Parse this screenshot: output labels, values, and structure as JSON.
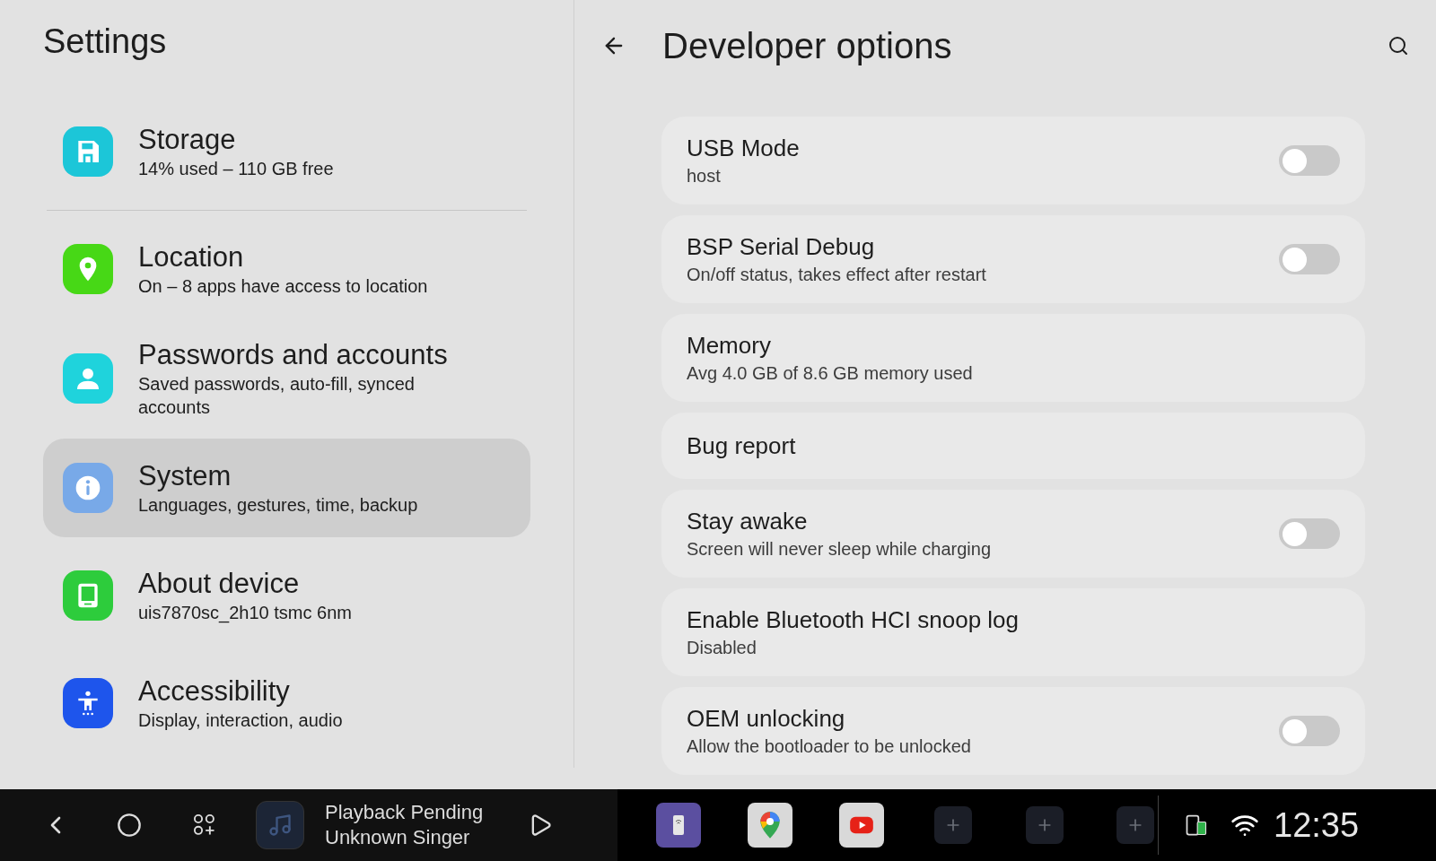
{
  "settings": {
    "title": "Settings",
    "items": [
      {
        "kind": "storage",
        "color": "#1cc6d8",
        "title": "Storage",
        "subtitle": "14% used – 110 GB free",
        "selected": false
      },
      {
        "kind": "location",
        "color": "#47d816",
        "title": "Location",
        "subtitle": "On – 8 apps have access to location",
        "selected": false
      },
      {
        "kind": "person",
        "color": "#1fd3dc",
        "title": "Passwords and accounts",
        "subtitle": "Saved passwords, auto-fill, synced accounts",
        "selected": false
      },
      {
        "kind": "info",
        "color": "#78a9e8",
        "title": "System",
        "subtitle": "Languages, gestures, time, backup",
        "selected": true
      },
      {
        "kind": "tablet",
        "color": "#2dcc3c",
        "title": "About device",
        "subtitle": "uis7870sc_2h10 tsmc 6nm",
        "selected": false
      },
      {
        "kind": "accessibility",
        "color": "#1e55ec",
        "title": "Accessibility",
        "subtitle": "Display, interaction, audio",
        "selected": false
      }
    ]
  },
  "developer": {
    "title": "Developer options",
    "options": [
      {
        "kind": "toggle",
        "title": "USB Mode",
        "subtitle": "host",
        "on": false
      },
      {
        "kind": "toggle",
        "title": "BSP Serial Debug",
        "subtitle": "On/off status, takes effect after restart",
        "on": false
      },
      {
        "kind": "info",
        "title": "Memory",
        "subtitle": "Avg 4.0 GB of 8.6 GB memory used"
      },
      {
        "kind": "info",
        "title": "Bug report"
      },
      {
        "kind": "toggle",
        "title": "Stay awake",
        "subtitle": "Screen will never sleep while charging",
        "on": false
      },
      {
        "kind": "info",
        "title": "Enable Bluetooth HCI snoop log",
        "subtitle": "Disabled"
      },
      {
        "kind": "toggle",
        "title": "OEM unlocking",
        "subtitle": "Allow the bootloader to be unlocked",
        "on": false
      }
    ]
  },
  "taskbar": {
    "media": {
      "title": "Playback Pending",
      "artist": "Unknown Singer"
    },
    "apps": [
      {
        "kind": "phone-link"
      },
      {
        "kind": "maps"
      },
      {
        "kind": "video"
      },
      {
        "kind": "add"
      },
      {
        "kind": "add"
      },
      {
        "kind": "add"
      }
    ],
    "time": "12:35"
  }
}
